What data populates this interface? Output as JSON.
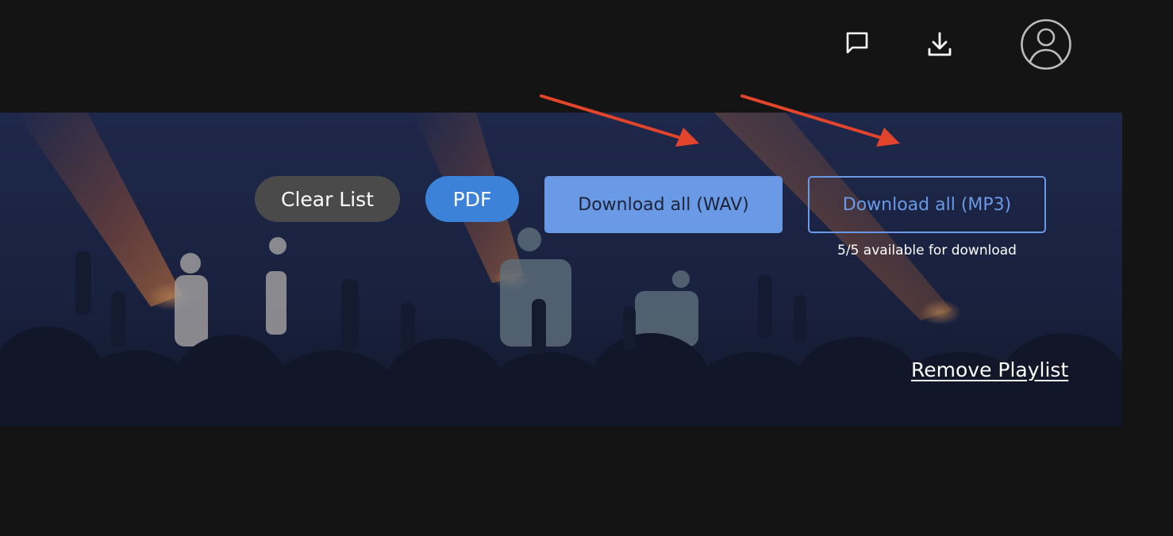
{
  "header": {
    "icons": {
      "chat": "chat-bubble-icon",
      "download": "download-icon",
      "avatar": "user-avatar-icon"
    }
  },
  "actions": {
    "clear_label": "Clear List",
    "pdf_label": "PDF",
    "wav_label": "Download all (WAV)",
    "mp3_label": "Download all (MP3)",
    "availability_text": "5/5 available for download",
    "remove_playlist_label": "Remove Playlist"
  },
  "colors": {
    "page_background": "#141414",
    "clear_button": "#4a4a4a",
    "pdf_button": "#3b82d8",
    "download_accent": "#6a9ae6",
    "annotation_arrow": "#e2452b"
  }
}
